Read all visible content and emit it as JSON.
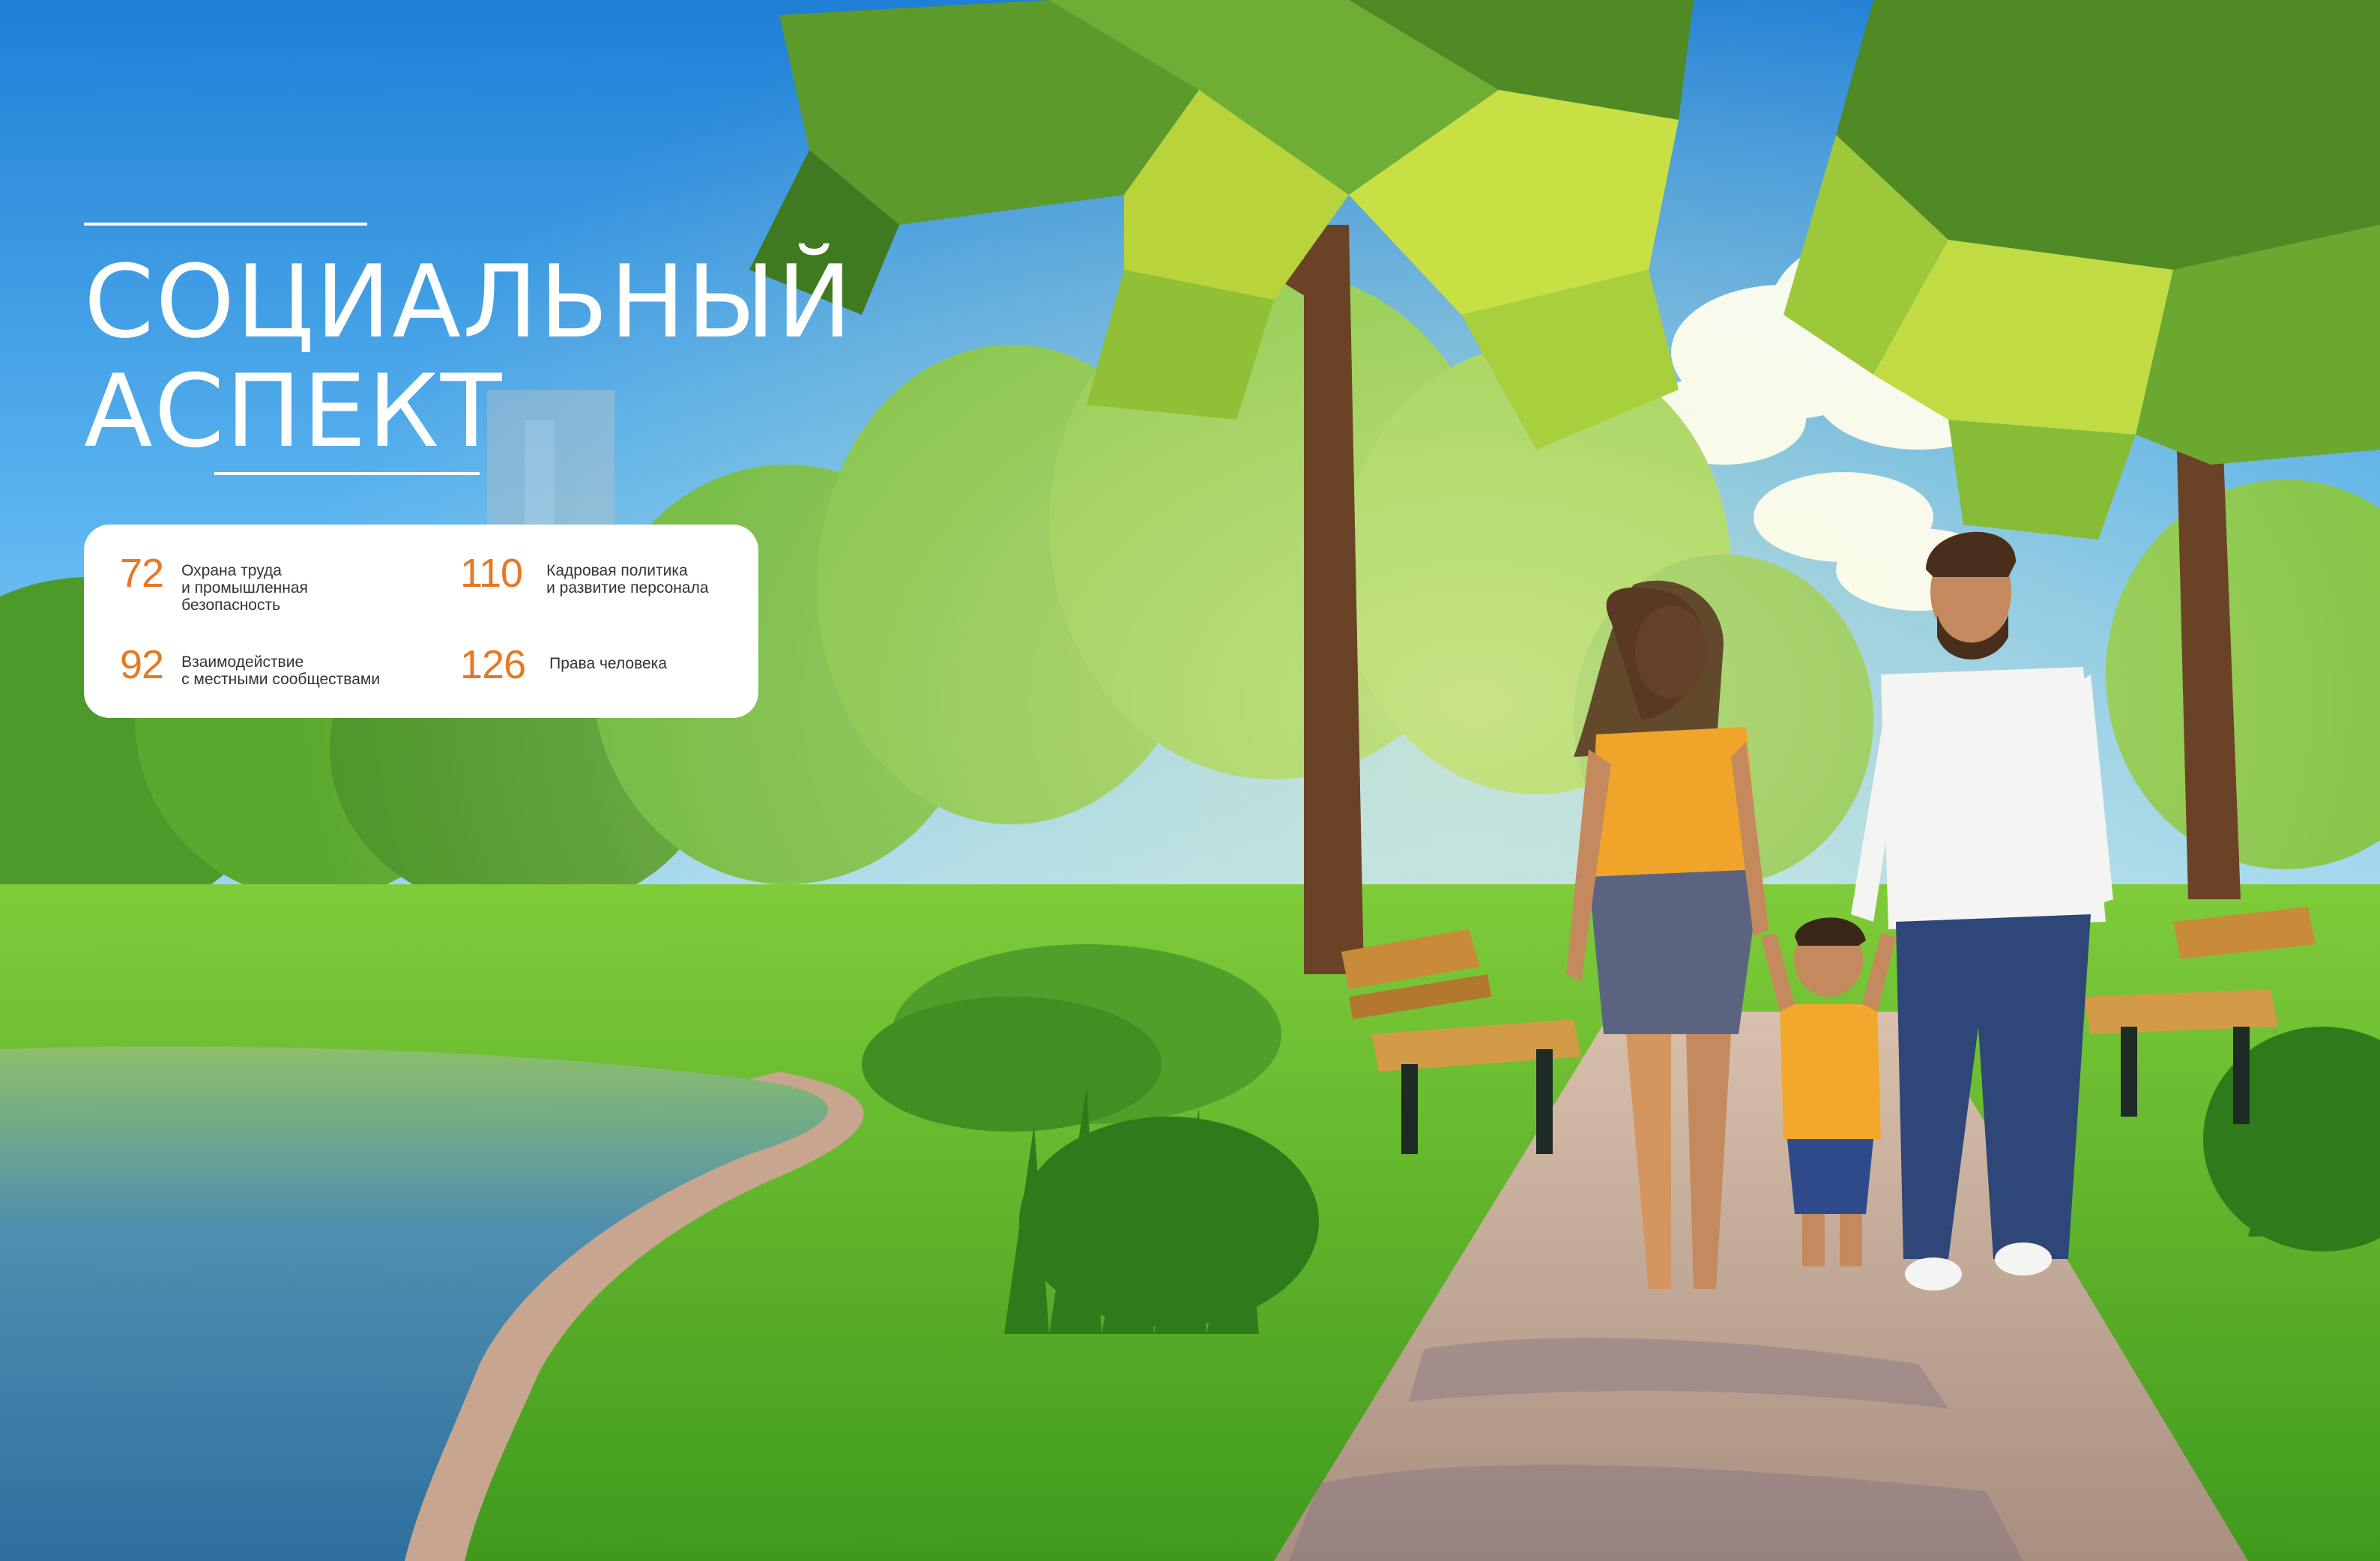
{
  "section": {
    "title_line1": "СОЦИАЛЬНЫЙ",
    "title_line2": "АСПЕКТ"
  },
  "contents": [
    {
      "page": "72",
      "label": "Охрана труда\nи промышленная\nбезопасность"
    },
    {
      "page": "110",
      "label": "Кадровая политика\nи развитие персонала"
    },
    {
      "page": "92",
      "label": "Взаимодействие\nс местными сообществами"
    },
    {
      "page": "126",
      "label": "Права человека"
    }
  ],
  "colors": {
    "accent": "#e87722",
    "text": "#333333",
    "sky": "#2f8fe0",
    "grass": "#6cbf2a",
    "tree_leaf": "#8fbf2a",
    "water": "#3f7fa8",
    "path": "#c9a892"
  },
  "illustration": {
    "scene": "park-walk-family-illustration",
    "figures": [
      "woman-figure",
      "child-figure",
      "man-figure"
    ],
    "objects": [
      "trees",
      "pond",
      "path",
      "benches",
      "city-tower",
      "clouds"
    ]
  }
}
